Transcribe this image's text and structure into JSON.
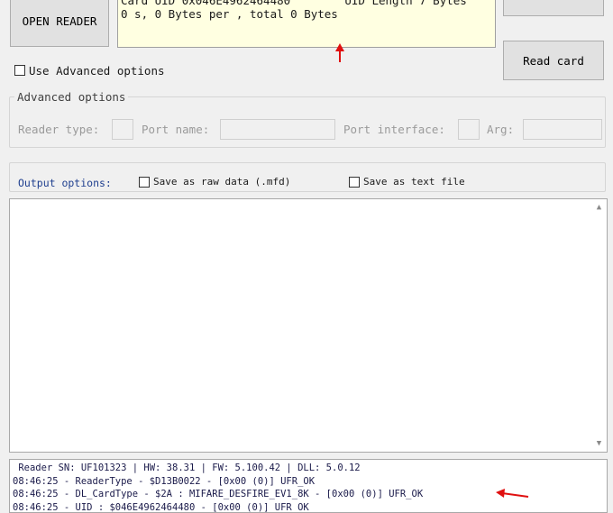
{
  "buttons": {
    "open_reader": "OPEN READER",
    "read_card": "Read card"
  },
  "info_box": {
    "line1": "Card UID 0x046E4962464480        UID Length 7 Bytes",
    "line2": "0 s, 0 Bytes per , total 0 Bytes"
  },
  "advanced_checkbox_label": "Use Advanced options",
  "advanced_group": {
    "legend": "Advanced options",
    "reader_type_label": "Reader type:",
    "port_name_label": "Port name:",
    "port_interface_label": "Port interface:",
    "arg_label": "Arg:"
  },
  "output_group": {
    "label": "Output options:",
    "save_raw_label": "Save as raw data (.mfd)",
    "save_text_label": "Save as text file"
  },
  "log_lines": [
    " Reader SN: UF101323 | HW: 38.31 | FW: 5.100.42 | DLL: 5.0.12",
    "08:46:25 - ReaderType - $D13B0022 - [0x00 (0)] UFR_OK",
    "08:46:25 - DL_CardType - $2A : MIFARE_DESFIRE_EV1_8K - [0x00 (0)] UFR_OK",
    "08:46:25 - UID : $046E4962464480 - [0x00 (0)] UFR_OK"
  ],
  "colors": {
    "annotation_arrow": "#e01010",
    "info_background": "#ffffe1",
    "window_background": "#f0f0f0"
  }
}
